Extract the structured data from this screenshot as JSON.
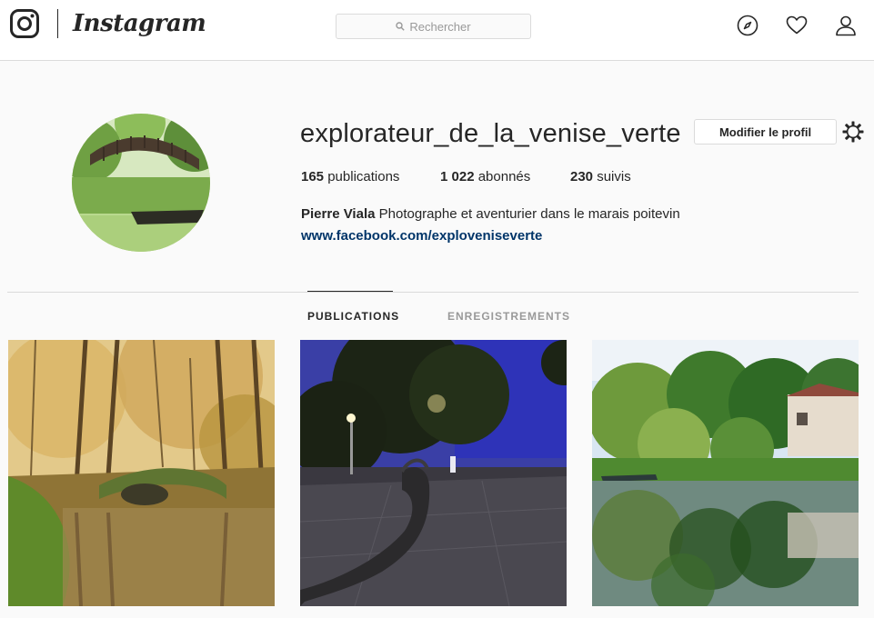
{
  "header": {
    "brand": "Instagram",
    "search_placeholder": "Rechercher",
    "icons": [
      "instagram-logo-icon",
      "search-icon",
      "compass-icon",
      "heart-icon",
      "user-icon"
    ]
  },
  "profile": {
    "username": "explorateur_de_la_venise_verte",
    "edit_button": "Modifier le profil",
    "settings_icon": "gear-icon",
    "stats": {
      "posts_count": "165",
      "posts_label": "publications",
      "followers_count": "1 022",
      "followers_label": "abonnés",
      "following_count": "230",
      "following_label": "suivis"
    },
    "bio": {
      "full_name": "Pierre Viala",
      "description": "Photographe et aventurier dans le marais poitevin",
      "website": "www.facebook.com/exploveniseverte"
    }
  },
  "tabs": [
    {
      "label": "PUBLICATIONS",
      "active": true
    },
    {
      "label": "ENREGISTREMENTS",
      "active": false
    }
  ],
  "posts": [
    {
      "subject": "autumn canal with stone bridge"
    },
    {
      "subject": "night plaza with sculpture"
    },
    {
      "subject": "green marsh with house reflection"
    }
  ],
  "colors": {
    "background": "#fafafa",
    "border": "#dbdbdb",
    "text": "#262626",
    "link": "#003569",
    "muted": "#999999"
  }
}
